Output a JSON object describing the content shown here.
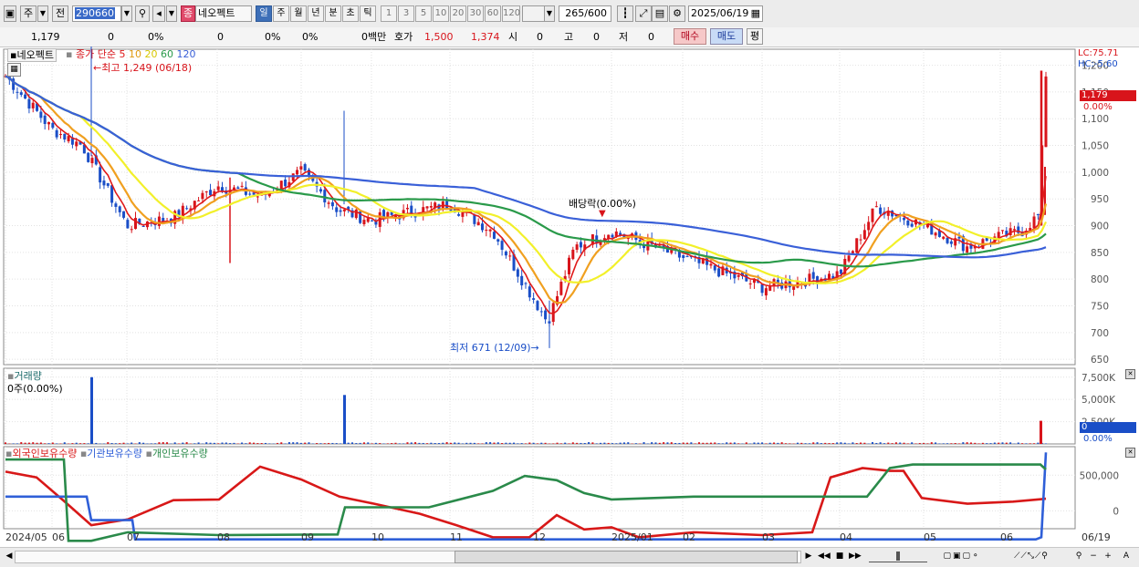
{
  "toolbar": {
    "market_label": "주",
    "all_label": "전",
    "code_value": "290660",
    "stock_name": "네오펙트",
    "stock_badge": "종",
    "periods_kor": [
      "일",
      "주",
      "월",
      "년",
      "분",
      "초",
      "틱"
    ],
    "periods_num": [
      "1",
      "3",
      "5",
      "10",
      "20",
      "30",
      "60",
      "120"
    ],
    "count_value": "265",
    "count_total": "/600",
    "date_value": "2025/06/19"
  },
  "info": {
    "price": "1,179",
    "change": "0",
    "change_rate": "0%",
    "volume": "0",
    "vol_rate": "0%",
    "vol_rate2": "0%",
    "amount": "0백만",
    "quote_label": "호가",
    "ask": "1,500",
    "bid": "1,374",
    "open_label": "시",
    "open_value": "0",
    "high_label": "고",
    "high_value": "0",
    "low_label": "저",
    "low_value": "0",
    "buy_label": "매수",
    "sell_label": "매도",
    "eval_label": "평"
  },
  "price_panel": {
    "name_tag": "네오펙트",
    "legend_prefix": "종가 단순",
    "ma_periods": [
      "5",
      "10",
      "20",
      "60",
      "120"
    ],
    "ma_colors": [
      "#e01a1a",
      "#f0a020",
      "#f2f02a",
      "#2a9a4a",
      "#3a60d8"
    ],
    "high_annotation": "최고 1,249 (06/18)",
    "low_annotation": "최저 671 (12/09)",
    "dividend_annotation": "배당락(0.00%)",
    "lc": "LC:75.71",
    "hc": "HC:-5.60",
    "current_price_tag": "1,179",
    "current_pct_tag": "0.00%"
  },
  "volume_panel": {
    "title": "거래량",
    "current": "0주(0.00%)",
    "current_tag": "0",
    "pct_tag": "0.00%"
  },
  "holdings_panel": {
    "legend": [
      "외국인보유수량",
      "기관보유수량",
      "개인보유수량"
    ],
    "colors": [
      "#d81818",
      "#2f5fd8",
      "#2a8a4a"
    ]
  },
  "x_axis": [
    "2024/05",
    "06",
    "07",
    "08",
    "09",
    "10",
    "11",
    "12",
    "2025/01",
    "02",
    "03",
    "04",
    "05",
    "06",
    "06/19"
  ],
  "chart_data": [
    {
      "type": "candlestick",
      "title": "네오펙트",
      "y_ticks": [
        650,
        700,
        750,
        800,
        850,
        900,
        950,
        1000,
        1050,
        1100,
        1150,
        1200
      ],
      "ylim": [
        640,
        1230
      ],
      "high": {
        "value": 1249,
        "date": "06/18"
      },
      "low": {
        "value": 671,
        "date": "12/09"
      },
      "close_path_approx": [
        {
          "x": "2024/05",
          "y": 1180
        },
        {
          "x": "06",
          "y": 1080
        },
        {
          "x": "06 mid",
          "y": 1050
        },
        {
          "x": "07",
          "y": 900
        },
        {
          "x": "07 mid",
          "y": 915
        },
        {
          "x": "08",
          "y": 975
        },
        {
          "x": "08 mid",
          "y": 955
        },
        {
          "x": "09",
          "y": 1000
        },
        {
          "x": "09 mid",
          "y": 930
        },
        {
          "x": "10",
          "y": 910
        },
        {
          "x": "11",
          "y": 940
        },
        {
          "x": "11 mid",
          "y": 890
        },
        {
          "x": "12",
          "y": 720
        },
        {
          "x": "12 mid",
          "y": 860
        },
        {
          "x": "2025/01",
          "y": 890
        },
        {
          "x": "02",
          "y": 840
        },
        {
          "x": "03",
          "y": 785
        },
        {
          "x": "03 mid",
          "y": 795
        },
        {
          "x": "04",
          "y": 810
        },
        {
          "x": "04 mid",
          "y": 935
        },
        {
          "x": "05",
          "y": 900
        },
        {
          "x": "05 mid",
          "y": 860
        },
        {
          "x": "06",
          "y": 880
        },
        {
          "x": "06/19",
          "y": 1179
        }
      ]
    },
    {
      "type": "bar",
      "title": "거래량",
      "y_ticks": [
        "2,500K",
        "5,000K",
        "7,500K"
      ],
      "spikes": [
        {
          "x": "06",
          "value": 7500
        },
        {
          "x": "09 mid",
          "value": 5500
        },
        {
          "x": "06/19",
          "value": 2600
        }
      ]
    },
    {
      "type": "line",
      "series_names": [
        "외국인보유수량",
        "기관보유수량",
        "개인보유수량"
      ],
      "y_ticks": [
        "0",
        "500,000"
      ]
    }
  ]
}
